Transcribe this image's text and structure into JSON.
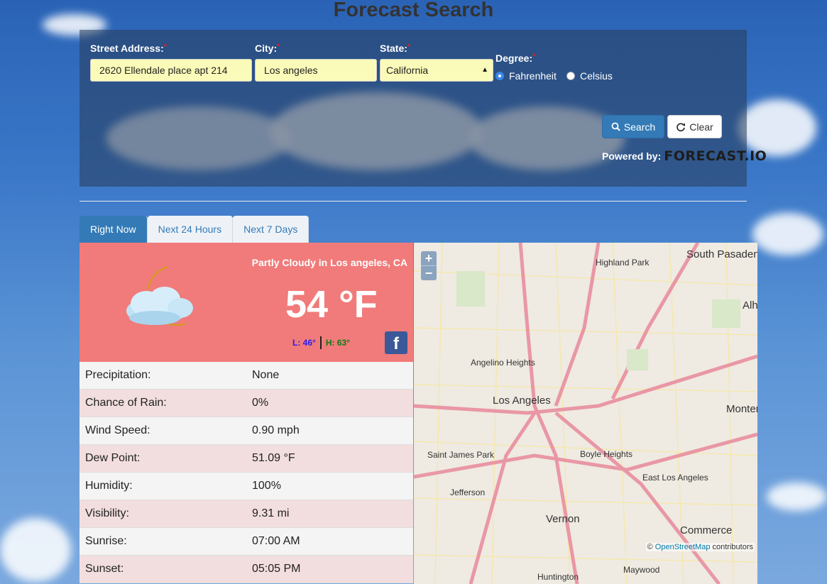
{
  "title": "Forecast Search",
  "form": {
    "street_label": "Street Address:",
    "street_value": "2620 Ellendale place apt 214",
    "city_label": "City:",
    "city_value": "Los angeles",
    "state_label": "State:",
    "state_value": "California",
    "degree_label": "Degree:",
    "required_mark": "*",
    "fahrenheit_label": "Fahrenheit",
    "celsius_label": "Celsius",
    "selected_degree": "Fahrenheit",
    "search_label": "Search",
    "clear_label": "Clear",
    "powered_by": "Powered by:",
    "powered_logo": "FORECAST.IO"
  },
  "tabs": [
    {
      "label": "Right Now",
      "active": true
    },
    {
      "label": "Next 24 Hours",
      "active": false
    },
    {
      "label": "Next 7 Days",
      "active": false
    }
  ],
  "current": {
    "summary": "Partly Cloudy in Los angeles, CA",
    "temperature": "54 °F",
    "low": "L: 46°",
    "high": "H: 63°",
    "icon": "partly-cloudy-night-icon"
  },
  "details": [
    {
      "label": "Precipitation:",
      "value": "None"
    },
    {
      "label": "Chance of Rain:",
      "value": "0%"
    },
    {
      "label": "Wind Speed:",
      "value": "0.90 mph"
    },
    {
      "label": "Dew Point:",
      "value": "51.09 °F"
    },
    {
      "label": "Humidity:",
      "value": "100%"
    },
    {
      "label": "Visibility:",
      "value": "9.31 mi"
    },
    {
      "label": "Sunrise:",
      "value": "07:00 AM"
    },
    {
      "label": "Sunset:",
      "value": "05:05 PM"
    }
  ],
  "map": {
    "zoom_in": "+",
    "zoom_out": "−",
    "attribution_prefix": "©",
    "attribution_link": "OpenStreetMap",
    "attribution_suffix": "contributors",
    "places": [
      "South Pasadena",
      "Highland Park",
      "Alh",
      "Angelino Heights",
      "Los Angeles",
      "Monter",
      "Saint James Park",
      "Boyle Heights",
      "East Los Angeles",
      "Jefferson",
      "Vernon",
      "Commerce",
      "Huntington",
      "Maywood"
    ]
  },
  "colors": {
    "accent": "#337ab7",
    "current_bg": "#f07b7a",
    "field_bg": "#fbfbb9"
  }
}
